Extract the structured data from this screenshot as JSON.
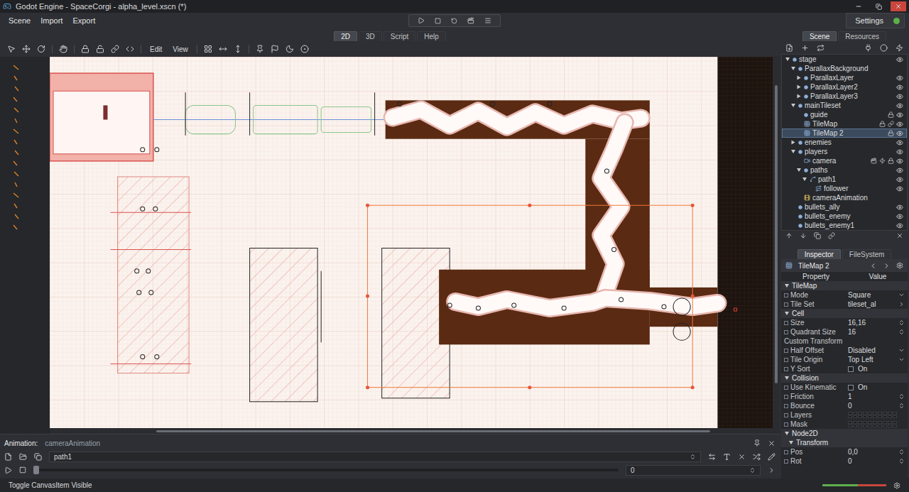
{
  "window": {
    "title": "Godot Engine - SpaceCorgi - alpha_level.xscn (*)"
  },
  "menu": [
    "Scene",
    "Import",
    "Export"
  ],
  "settings": {
    "label": "Settings"
  },
  "main_tabs": [
    {
      "label": "2D",
      "selected": true
    },
    {
      "label": "3D",
      "selected": false
    },
    {
      "label": "Script",
      "selected": false
    },
    {
      "label": "Help",
      "selected": false
    }
  ],
  "toolbar": {
    "menus": [
      "Edit",
      "View"
    ]
  },
  "dock_tabs": [
    {
      "label": "Scene",
      "selected": true
    },
    {
      "label": "Resources",
      "selected": false
    }
  ],
  "scene_tree": [
    {
      "name": "stage",
      "depth": 0,
      "kind": "node",
      "has_children": true,
      "expanded": true,
      "selected": false,
      "locked": false,
      "linked": false,
      "scripted": false,
      "signals": false,
      "eye": true
    },
    {
      "name": "ParallaxBackground",
      "depth": 1,
      "kind": "node",
      "has_children": true,
      "expanded": true,
      "selected": false,
      "locked": false,
      "linked": false,
      "scripted": false,
      "signals": false,
      "eye": false
    },
    {
      "name": "ParallaxLayer",
      "depth": 2,
      "kind": "node",
      "has_children": true,
      "expanded": false,
      "selected": false,
      "locked": false,
      "linked": false,
      "scripted": false,
      "signals": false,
      "eye": true
    },
    {
      "name": "ParallaxLayer2",
      "depth": 2,
      "kind": "node",
      "has_children": true,
      "expanded": false,
      "selected": false,
      "locked": false,
      "linked": false,
      "scripted": false,
      "signals": false,
      "eye": true
    },
    {
      "name": "ParallaxLayer3",
      "depth": 2,
      "kind": "node",
      "has_children": true,
      "expanded": false,
      "selected": false,
      "locked": false,
      "linked": false,
      "scripted": false,
      "signals": false,
      "eye": true
    },
    {
      "name": "mainTileset",
      "depth": 1,
      "kind": "node",
      "has_children": true,
      "expanded": true,
      "selected": false,
      "locked": false,
      "linked": false,
      "scripted": false,
      "signals": false,
      "eye": true
    },
    {
      "name": "guide",
      "depth": 2,
      "kind": "node",
      "has_children": false,
      "expanded": false,
      "selected": false,
      "locked": true,
      "linked": false,
      "scripted": false,
      "signals": false,
      "eye": true
    },
    {
      "name": "TileMap",
      "depth": 2,
      "kind": "tilemap",
      "has_children": false,
      "expanded": false,
      "selected": false,
      "locked": true,
      "linked": true,
      "scripted": false,
      "signals": false,
      "eye": true
    },
    {
      "name": "TileMap 2",
      "depth": 2,
      "kind": "tilemap",
      "has_children": false,
      "expanded": false,
      "selected": true,
      "locked": true,
      "linked": false,
      "scripted": false,
      "signals": false,
      "eye": true
    },
    {
      "name": "enemies",
      "depth": 1,
      "kind": "node",
      "has_children": true,
      "expanded": false,
      "selected": false,
      "locked": false,
      "linked": false,
      "scripted": false,
      "signals": false,
      "eye": true
    },
    {
      "name": "players",
      "depth": 1,
      "kind": "node",
      "has_children": true,
      "expanded": true,
      "selected": false,
      "locked": false,
      "linked": false,
      "scripted": false,
      "signals": false,
      "eye": true
    },
    {
      "name": "camera",
      "depth": 2,
      "kind": "camera",
      "has_children": false,
      "expanded": false,
      "selected": false,
      "locked": true,
      "linked": false,
      "scripted": true,
      "signals": true,
      "eye": true
    },
    {
      "name": "paths",
      "depth": 2,
      "kind": "node",
      "has_children": true,
      "expanded": true,
      "selected": false,
      "locked": false,
      "linked": false,
      "scripted": false,
      "signals": false,
      "eye": true
    },
    {
      "name": "path1",
      "depth": 3,
      "kind": "path",
      "has_children": true,
      "expanded": true,
      "selected": false,
      "locked": false,
      "linked": false,
      "scripted": false,
      "signals": false,
      "eye": true
    },
    {
      "name": "follower",
      "depth": 4,
      "kind": "follow",
      "has_children": false,
      "expanded": false,
      "selected": false,
      "locked": false,
      "linked": false,
      "scripted": false,
      "signals": false,
      "eye": true
    },
    {
      "name": "cameraAnimation",
      "depth": 2,
      "kind": "animation",
      "has_children": false,
      "expanded": false,
      "selected": false,
      "locked": false,
      "linked": false,
      "scripted": false,
      "signals": false,
      "eye": false
    },
    {
      "name": "bullets_ally",
      "depth": 1,
      "kind": "node",
      "has_children": false,
      "expanded": false,
      "selected": false,
      "locked": false,
      "linked": false,
      "scripted": false,
      "signals": false,
      "eye": true
    },
    {
      "name": "bullets_enemy",
      "depth": 1,
      "kind": "node",
      "has_children": false,
      "expanded": false,
      "selected": false,
      "locked": false,
      "linked": false,
      "scripted": false,
      "signals": false,
      "eye": true
    },
    {
      "name": "bullets_enemy1",
      "depth": 1,
      "kind": "node",
      "has_children": false,
      "expanded": false,
      "selected": false,
      "locked": false,
      "linked": false,
      "scripted": false,
      "signals": false,
      "eye": true
    }
  ],
  "inspector_tabs": [
    {
      "label": "Inspector",
      "selected": true
    },
    {
      "label": "FileSystem",
      "selected": false
    }
  ],
  "inspector": {
    "object": "TileMap 2",
    "columns": [
      "Property",
      "Value"
    ],
    "rows": [
      {
        "kind": "section",
        "label": "TileMap",
        "depth": 0,
        "expanded": true
      },
      {
        "kind": "dropdown",
        "label": "Mode",
        "value": "Square"
      },
      {
        "kind": "resource",
        "label": "Tile Set",
        "value": "tileset_al"
      },
      {
        "kind": "section",
        "label": "Cell",
        "depth": 0,
        "expanded": true
      },
      {
        "kind": "spin",
        "label": "Size",
        "value": "16,16"
      },
      {
        "kind": "spin",
        "label": "Quadrant Size",
        "value": "16"
      },
      {
        "kind": "label",
        "label": "Custom Transform"
      },
      {
        "kind": "dropdown",
        "label": "Half Offset",
        "value": "Disabled"
      },
      {
        "kind": "dropdown",
        "label": "Tile Origin",
        "value": "Top Left"
      },
      {
        "kind": "checkbox",
        "label": "Y Sort",
        "value": "On",
        "checked": false
      },
      {
        "kind": "section",
        "label": "Collision",
        "depth": 0,
        "expanded": true
      },
      {
        "kind": "checkbox",
        "label": "Use Kinematic",
        "value": "On",
        "checked": false
      },
      {
        "kind": "spin",
        "label": "Friction",
        "value": "1"
      },
      {
        "kind": "spin",
        "label": "Bounce",
        "value": "0"
      },
      {
        "kind": "layers",
        "label": "Layers"
      },
      {
        "kind": "layers",
        "label": "Mask"
      },
      {
        "kind": "section",
        "label": "Node2D",
        "depth": 0,
        "expanded": true
      },
      {
        "kind": "section",
        "label": "Transform",
        "depth": 1,
        "expanded": true
      },
      {
        "kind": "spin",
        "label": "Pos",
        "value": "0,0"
      },
      {
        "kind": "spin",
        "label": "Rot",
        "value": "0"
      }
    ]
  },
  "animation": {
    "label": "Animation:",
    "name": "cameraAnimation",
    "track": "path1",
    "time": "0",
    "level": 0
  },
  "status_bar": "Toggle CanvasItem Visible"
}
